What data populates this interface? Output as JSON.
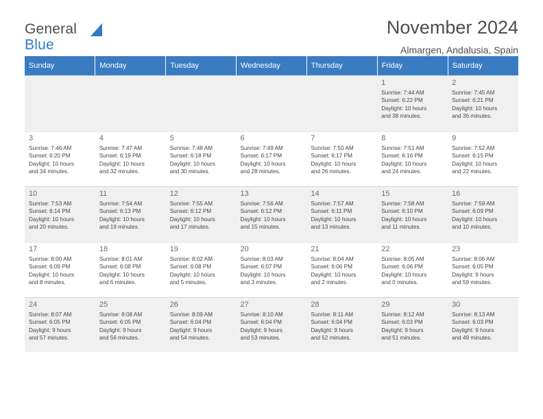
{
  "logo": {
    "line1": "General",
    "line2": "Blue"
  },
  "header": {
    "month_title": "November 2024",
    "location": "Almargen, Andalusia, Spain"
  },
  "calendar": {
    "weekday_headers": [
      "Sunday",
      "Monday",
      "Tuesday",
      "Wednesday",
      "Thursday",
      "Friday",
      "Saturday"
    ],
    "weeks": [
      [
        {
          "empty": true
        },
        {
          "empty": true
        },
        {
          "empty": true
        },
        {
          "empty": true
        },
        {
          "empty": true
        },
        {
          "day": "1",
          "sunrise": "Sunrise: 7:44 AM",
          "sunset": "Sunset: 6:22 PM",
          "daylight1": "Daylight: 10 hours",
          "daylight2": "and 38 minutes."
        },
        {
          "day": "2",
          "sunrise": "Sunrise: 7:45 AM",
          "sunset": "Sunset: 6:21 PM",
          "daylight1": "Daylight: 10 hours",
          "daylight2": "and 36 minutes."
        }
      ],
      [
        {
          "day": "3",
          "sunrise": "Sunrise: 7:46 AM",
          "sunset": "Sunset: 6:20 PM",
          "daylight1": "Daylight: 10 hours",
          "daylight2": "and 34 minutes."
        },
        {
          "day": "4",
          "sunrise": "Sunrise: 7:47 AM",
          "sunset": "Sunset: 6:19 PM",
          "daylight1": "Daylight: 10 hours",
          "daylight2": "and 32 minutes."
        },
        {
          "day": "5",
          "sunrise": "Sunrise: 7:48 AM",
          "sunset": "Sunset: 6:18 PM",
          "daylight1": "Daylight: 10 hours",
          "daylight2": "and 30 minutes."
        },
        {
          "day": "6",
          "sunrise": "Sunrise: 7:49 AM",
          "sunset": "Sunset: 6:17 PM",
          "daylight1": "Daylight: 10 hours",
          "daylight2": "and 28 minutes."
        },
        {
          "day": "7",
          "sunrise": "Sunrise: 7:50 AM",
          "sunset": "Sunset: 6:17 PM",
          "daylight1": "Daylight: 10 hours",
          "daylight2": "and 26 minutes."
        },
        {
          "day": "8",
          "sunrise": "Sunrise: 7:51 AM",
          "sunset": "Sunset: 6:16 PM",
          "daylight1": "Daylight: 10 hours",
          "daylight2": "and 24 minutes."
        },
        {
          "day": "9",
          "sunrise": "Sunrise: 7:52 AM",
          "sunset": "Sunset: 6:15 PM",
          "daylight1": "Daylight: 10 hours",
          "daylight2": "and 22 minutes."
        }
      ],
      [
        {
          "day": "10",
          "sunrise": "Sunrise: 7:53 AM",
          "sunset": "Sunset: 6:14 PM",
          "daylight1": "Daylight: 10 hours",
          "daylight2": "and 20 minutes."
        },
        {
          "day": "11",
          "sunrise": "Sunrise: 7:54 AM",
          "sunset": "Sunset: 6:13 PM",
          "daylight1": "Daylight: 10 hours",
          "daylight2": "and 19 minutes."
        },
        {
          "day": "12",
          "sunrise": "Sunrise: 7:55 AM",
          "sunset": "Sunset: 6:12 PM",
          "daylight1": "Daylight: 10 hours",
          "daylight2": "and 17 minutes."
        },
        {
          "day": "13",
          "sunrise": "Sunrise: 7:56 AM",
          "sunset": "Sunset: 6:12 PM",
          "daylight1": "Daylight: 10 hours",
          "daylight2": "and 15 minutes."
        },
        {
          "day": "14",
          "sunrise": "Sunrise: 7:57 AM",
          "sunset": "Sunset: 6:11 PM",
          "daylight1": "Daylight: 10 hours",
          "daylight2": "and 13 minutes."
        },
        {
          "day": "15",
          "sunrise": "Sunrise: 7:58 AM",
          "sunset": "Sunset: 6:10 PM",
          "daylight1": "Daylight: 10 hours",
          "daylight2": "and 11 minutes."
        },
        {
          "day": "16",
          "sunrise": "Sunrise: 7:59 AM",
          "sunset": "Sunset: 6:09 PM",
          "daylight1": "Daylight: 10 hours",
          "daylight2": "and 10 minutes."
        }
      ],
      [
        {
          "day": "17",
          "sunrise": "Sunrise: 8:00 AM",
          "sunset": "Sunset: 6:09 PM",
          "daylight1": "Daylight: 10 hours",
          "daylight2": "and 8 minutes."
        },
        {
          "day": "18",
          "sunrise": "Sunrise: 8:01 AM",
          "sunset": "Sunset: 6:08 PM",
          "daylight1": "Daylight: 10 hours",
          "daylight2": "and 6 minutes."
        },
        {
          "day": "19",
          "sunrise": "Sunrise: 8:02 AM",
          "sunset": "Sunset: 6:08 PM",
          "daylight1": "Daylight: 10 hours",
          "daylight2": "and 5 minutes."
        },
        {
          "day": "20",
          "sunrise": "Sunrise: 8:03 AM",
          "sunset": "Sunset: 6:07 PM",
          "daylight1": "Daylight: 10 hours",
          "daylight2": "and 3 minutes."
        },
        {
          "day": "21",
          "sunrise": "Sunrise: 8:04 AM",
          "sunset": "Sunset: 6:06 PM",
          "daylight1": "Daylight: 10 hours",
          "daylight2": "and 2 minutes."
        },
        {
          "day": "22",
          "sunrise": "Sunrise: 8:05 AM",
          "sunset": "Sunset: 6:06 PM",
          "daylight1": "Daylight: 10 hours",
          "daylight2": "and 0 minutes."
        },
        {
          "day": "23",
          "sunrise": "Sunrise: 8:06 AM",
          "sunset": "Sunset: 6:05 PM",
          "daylight1": "Daylight: 9 hours",
          "daylight2": "and 59 minutes."
        }
      ],
      [
        {
          "day": "24",
          "sunrise": "Sunrise: 8:07 AM",
          "sunset": "Sunset: 6:05 PM",
          "daylight1": "Daylight: 9 hours",
          "daylight2": "and 57 minutes."
        },
        {
          "day": "25",
          "sunrise": "Sunrise: 8:08 AM",
          "sunset": "Sunset: 6:05 PM",
          "daylight1": "Daylight: 9 hours",
          "daylight2": "and 56 minutes."
        },
        {
          "day": "26",
          "sunrise": "Sunrise: 8:09 AM",
          "sunset": "Sunset: 6:04 PM",
          "daylight1": "Daylight: 9 hours",
          "daylight2": "and 54 minutes."
        },
        {
          "day": "27",
          "sunrise": "Sunrise: 8:10 AM",
          "sunset": "Sunset: 6:04 PM",
          "daylight1": "Daylight: 9 hours",
          "daylight2": "and 53 minutes."
        },
        {
          "day": "28",
          "sunrise": "Sunrise: 8:11 AM",
          "sunset": "Sunset: 6:04 PM",
          "daylight1": "Daylight: 9 hours",
          "daylight2": "and 52 minutes."
        },
        {
          "day": "29",
          "sunrise": "Sunrise: 8:12 AM",
          "sunset": "Sunset: 6:03 PM",
          "daylight1": "Daylight: 9 hours",
          "daylight2": "and 51 minutes."
        },
        {
          "day": "30",
          "sunrise": "Sunrise: 8:13 AM",
          "sunset": "Sunset: 6:03 PM",
          "daylight1": "Daylight: 9 hours",
          "daylight2": "and 49 minutes."
        }
      ]
    ]
  },
  "colors": {
    "header_blue": "#3a7cc2",
    "logo_blue": "#2f7bc5",
    "shaded_cell": "#f0f0f0",
    "cell_border": "#c8d8ea"
  }
}
